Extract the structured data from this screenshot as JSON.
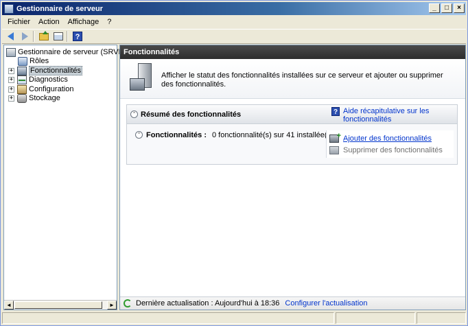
{
  "window": {
    "title": "Gestionnaire de serveur",
    "controls": {
      "minimize": "_",
      "maximize": "□",
      "close": "×"
    }
  },
  "menu": {
    "items": [
      "Fichier",
      "Action",
      "Affichage",
      "?"
    ]
  },
  "toolbar": {
    "icons": [
      "back-arrow-icon",
      "forward-arrow-icon",
      "up-folder-icon",
      "show-hide-pane-icon",
      "help-icon"
    ]
  },
  "tree": {
    "items": [
      {
        "label": "Gestionnaire de serveur (SRVFRDEI",
        "expander": "",
        "icon": "server-icon"
      },
      {
        "label": "Rôles",
        "expander": "",
        "icon": "roles-icon"
      },
      {
        "label": "Fonctionnalités",
        "expander": "+",
        "icon": "features-icon"
      },
      {
        "label": "Diagnostics",
        "expander": "+",
        "icon": "diagnostics-icon"
      },
      {
        "label": "Configuration",
        "expander": "+",
        "icon": "configuration-icon"
      },
      {
        "label": "Stockage",
        "expander": "+",
        "icon": "storage-icon"
      }
    ],
    "scroll": {
      "left": "◄",
      "right": "►"
    }
  },
  "content": {
    "header": "Fonctionnalités",
    "intro": "Afficher le statut des fonctionnalités installées sur ce serveur et ajouter ou supprimer des fonctionnalités.",
    "summary": {
      "title": "Résumé des fonctionnalités",
      "help_link": "Aide récapitulative sur les fonctionnalités",
      "features_label": "Fonctionnalités :",
      "features_value": "0 fonctionnalité(s) sur 41 installée(s)",
      "collapse_glyph": "⌃",
      "actions": {
        "add": "Ajouter des fonctionnalités",
        "remove": "Supprimer des fonctionnalités"
      }
    },
    "refresh": {
      "text": "Dernière actualisation : Aujourd'hui à 18:36",
      "configure_link": "Configurer l'actualisation"
    }
  },
  "colors": {
    "header_bg": "#2d2d2d",
    "link": "#0033cc",
    "title_bar": "#0a246a"
  }
}
